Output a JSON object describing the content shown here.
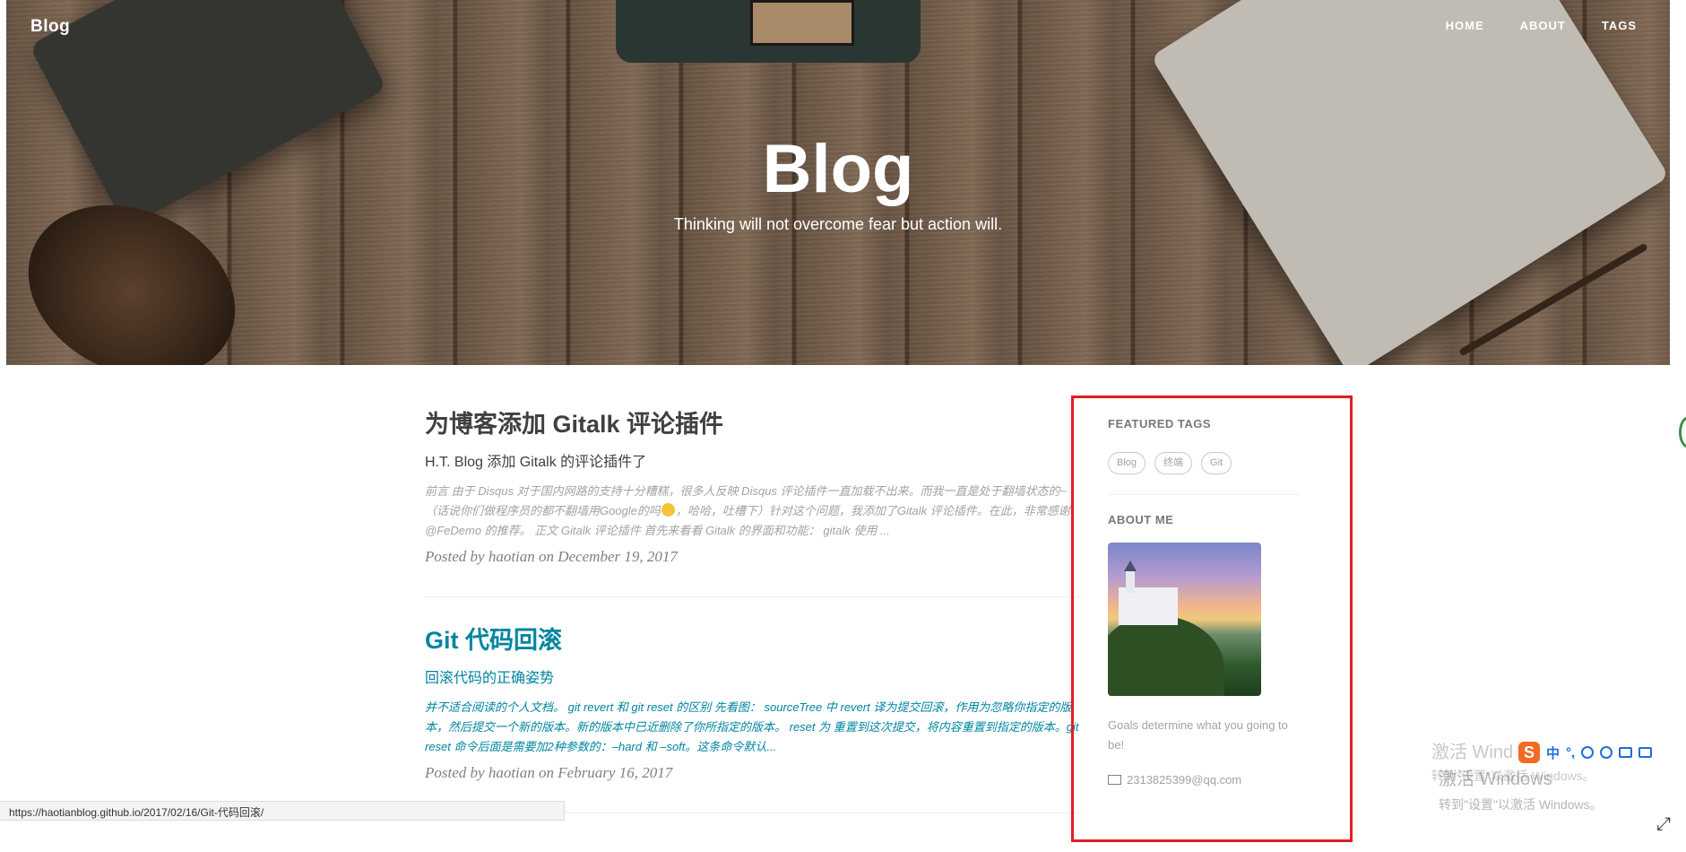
{
  "header": {
    "brand": "Blog",
    "nav": [
      "HOME",
      "ABOUT",
      "TAGS"
    ],
    "title": "Blog",
    "subtitle": "Thinking will not overcome fear but action will."
  },
  "posts": [
    {
      "title": "为博客添加 Gitalk 评论插件",
      "subtitle": "H.T. Blog 添加 Gitalk 的评论插件了",
      "excerpt_a": "前言 由于 Disqus 对于国内网路的支持十分糟糕，很多人反映 Disqus 评论插件一直加载不出来。而我一直是处于翻墙状态的~（话说你们做程序员的都不翻墙用Google的吗",
      "excerpt_b": "，哈哈，吐槽下）针对这个问题，我添加了Gitalk 评论插件。在此，非常感谢 @FeDemo 的推荐。 正文 Gitalk 评论插件 首先来看看 Gitalk 的界面和功能： gitalk 使用 ...",
      "meta": "Posted by haotian on December 19, 2017"
    },
    {
      "title": "Git 代码回滚",
      "subtitle": "回滚代码的正确姿势",
      "excerpt": "并不适合阅读的个人文档。 git revert 和 git reset 的区别 先看图： sourceTree 中 revert 译为提交回滚，作用为忽略你指定的版本，然后提交一个新的版本。新的版本中已近删除了你所指定的版本。 reset 为 重置到这次提交，将内容重置到指定的版本。git reset 命令后面是需要加2种参数的：–hard 和 –soft。这条命令默认...",
      "meta": "Posted by haotian on February 16, 2017"
    }
  ],
  "sidebar": {
    "featured_tags_heading": "FEATURED TAGS",
    "tags": [
      "Blog",
      "终端",
      "Git"
    ],
    "about_heading": "ABOUT ME",
    "about_text": "Goals determine what you going to be!",
    "email": "2313825399@qq.com",
    "highlight_color": "#e51c23"
  },
  "statusbar": {
    "url": "https://haotianblog.github.io/2017/02/16/Git-代码回滚/"
  },
  "system": {
    "watermark_title": "激活 Windows",
    "watermark_sub": "转到\"设置\"以激活 Windows。",
    "watermark_title_2": "激活 Wind",
    "watermark_sub_2": "转到\"设置\"以激活 Windows。",
    "ime_logo": "S",
    "ime_mode": "中",
    "ime_punct": "°,"
  }
}
